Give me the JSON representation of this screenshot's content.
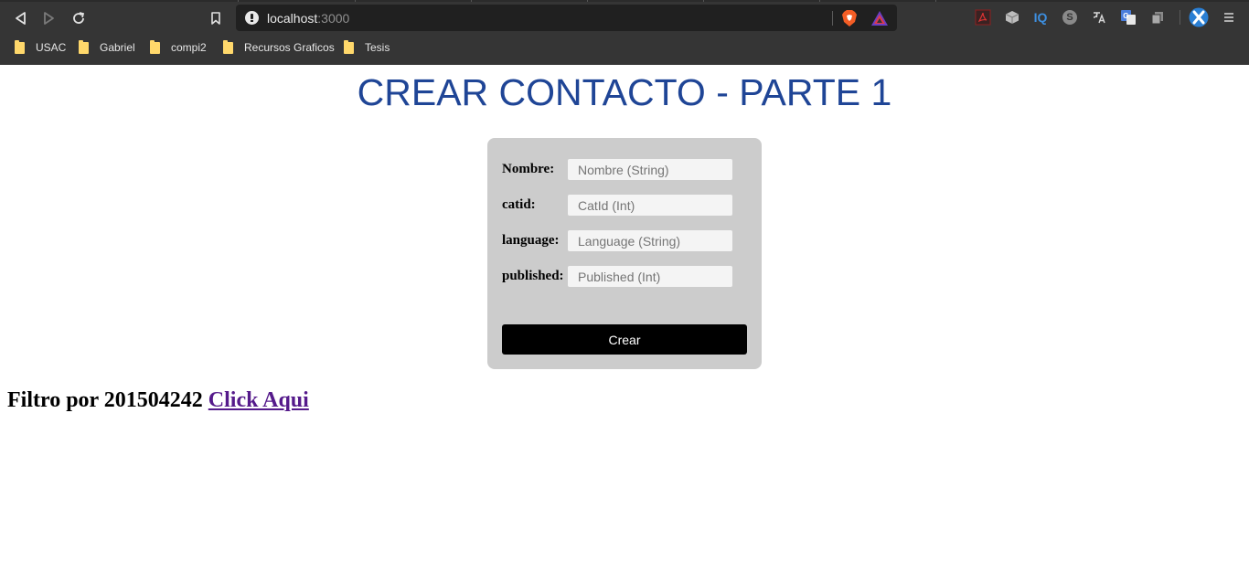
{
  "browser": {
    "url_host": "localhost",
    "url_port": ":3000",
    "bookmarks": [
      {
        "label": "USAC"
      },
      {
        "label": "Gabriel"
      },
      {
        "label": "compi2"
      },
      {
        "label": "Recursos Graficos"
      },
      {
        "label": "Tesis"
      }
    ],
    "extensions": [
      "pdf-icon",
      "cube-icon",
      "iq-icon",
      "s-icon",
      "translate-glyph-icon",
      "google-translate-icon",
      "copy-icon",
      "x-logo-icon",
      "menu-icon"
    ],
    "ext_labels": {
      "iq": "IQ",
      "s": "S"
    }
  },
  "page": {
    "title": "CREAR CONTACTO - PARTE 1",
    "form": {
      "fields": [
        {
          "label": "Nombre:",
          "placeholder": "Nombre (String)"
        },
        {
          "label": "catid:",
          "placeholder": "CatId (Int)"
        },
        {
          "label": "language:",
          "placeholder": "Language (String)"
        },
        {
          "label": "published:",
          "placeholder": "Published (Int)"
        }
      ],
      "submit_label": "Crear"
    },
    "filter": {
      "text": "Filtro por 201504242 ",
      "link_label": "Click Aqui"
    }
  },
  "colors": {
    "title": "#1f4596",
    "card": "#cccccc",
    "button": "#000000",
    "link": "#551a8b",
    "chrome": "#353535"
  }
}
